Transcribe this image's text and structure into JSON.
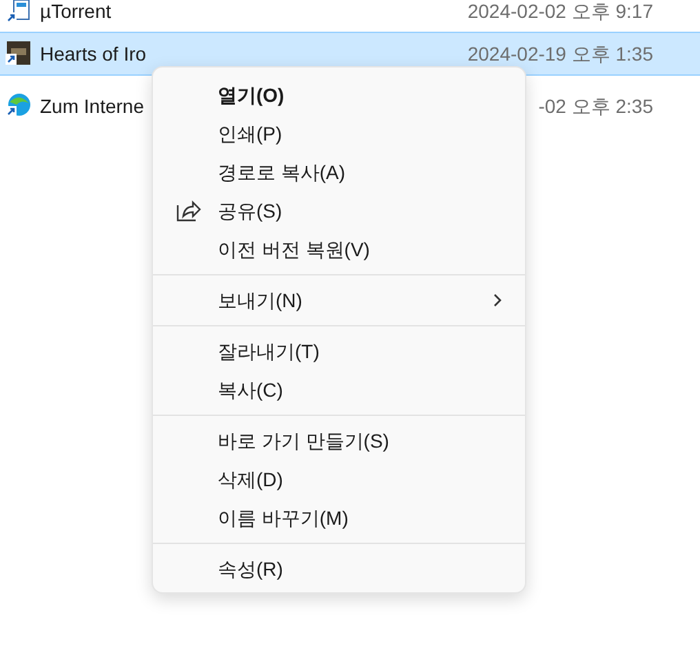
{
  "files": [
    {
      "name": "µTorrent",
      "modified": "2024-02-02 오후 9:17",
      "selected": false
    },
    {
      "name": "Hearts of Iro",
      "modified": "2024-02-19 오후 1:35",
      "selected": true
    },
    {
      "name": "Zum Interne",
      "modified": "-02 오후 2:35",
      "selected": false
    }
  ],
  "context_menu": [
    {
      "kind": "default",
      "label": "열기(O)"
    },
    {
      "kind": "item",
      "label": "인쇄(P)"
    },
    {
      "kind": "item",
      "label": "경로로 복사(A)"
    },
    {
      "kind": "share",
      "label": "공유(S)"
    },
    {
      "kind": "item",
      "label": "이전 버전 복원(V)"
    },
    {
      "kind": "separator"
    },
    {
      "kind": "submenu",
      "label": "보내기(N)"
    },
    {
      "kind": "separator"
    },
    {
      "kind": "item",
      "label": "잘라내기(T)"
    },
    {
      "kind": "item",
      "label": "복사(C)"
    },
    {
      "kind": "separator"
    },
    {
      "kind": "item",
      "label": "바로 가기 만들기(S)"
    },
    {
      "kind": "item",
      "label": "삭제(D)"
    },
    {
      "kind": "item",
      "label": "이름 바꾸기(M)"
    },
    {
      "kind": "separator"
    },
    {
      "kind": "item",
      "label": "속성(R)"
    }
  ]
}
